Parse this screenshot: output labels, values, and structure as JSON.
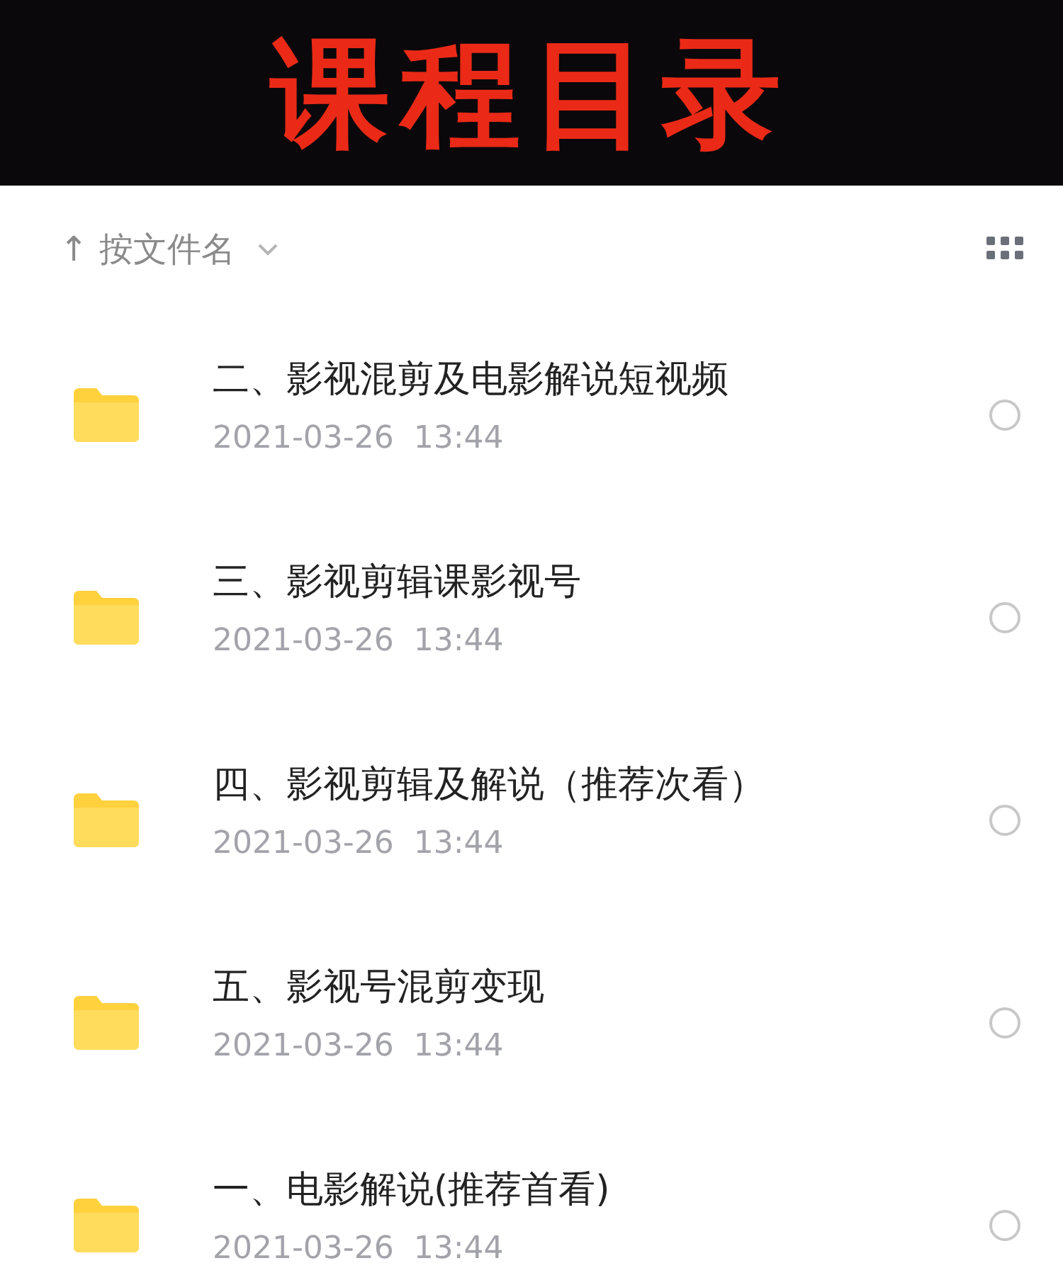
{
  "banner": {
    "title": "课程目录"
  },
  "sort": {
    "arrow": "↑",
    "label": "按文件名"
  },
  "files": [
    {
      "name": "二、影视混剪及电影解说短视频",
      "date": "2021-03-26  13:44",
      "selected": false
    },
    {
      "name": "三、影视剪辑课影视号",
      "date": "2021-03-26  13:44",
      "selected": false
    },
    {
      "name": "四、影视剪辑及解说（推荐次看）",
      "date": "2021-03-26  13:44",
      "selected": false
    },
    {
      "name": "五、影视号混剪变现",
      "date": "2021-03-26  13:44",
      "selected": false
    },
    {
      "name": "一、电影解说(推荐首看)",
      "date": "2021-03-26  13:44",
      "selected": false
    }
  ]
}
